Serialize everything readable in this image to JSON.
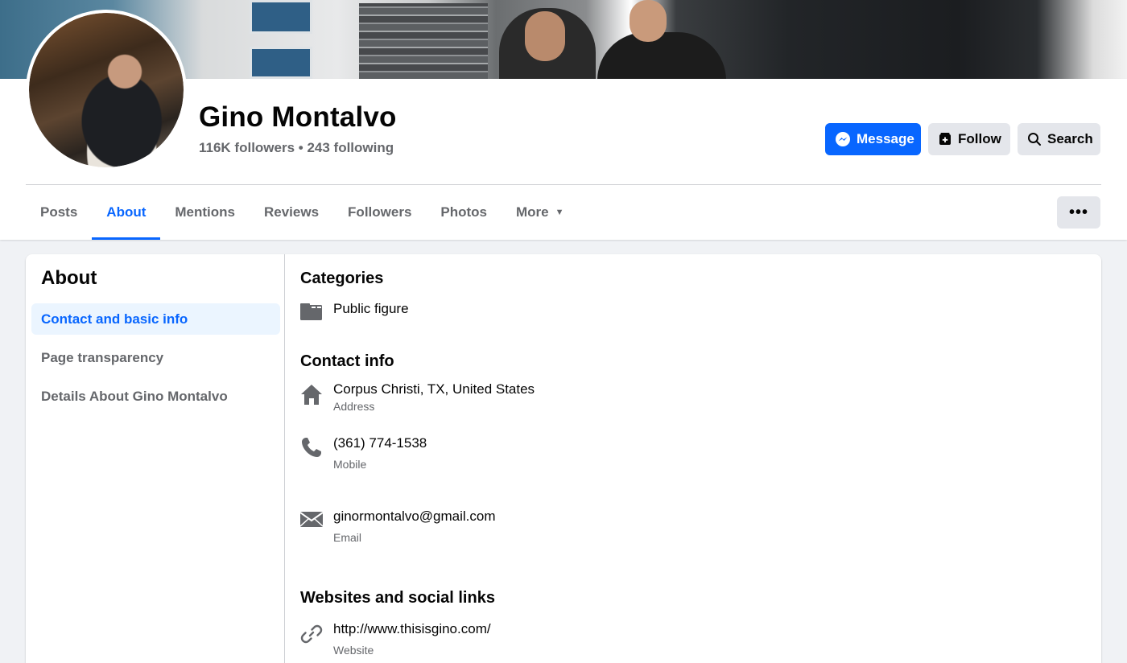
{
  "profile": {
    "name": "Gino Montalvo",
    "stats": "116K followers • 243 following"
  },
  "actions": {
    "message_label": "Message",
    "follow_label": "Follow",
    "search_label": "Search",
    "message_color": "#0866ff"
  },
  "tabs": [
    {
      "label": "Posts"
    },
    {
      "label": "About"
    },
    {
      "label": "Mentions"
    },
    {
      "label": "Reviews"
    },
    {
      "label": "Followers"
    },
    {
      "label": "Photos"
    },
    {
      "label": "More"
    }
  ],
  "more_menu_label": "•••",
  "about": {
    "title": "About",
    "nav": [
      {
        "label": "Contact and basic info"
      },
      {
        "label": "Page transparency"
      },
      {
        "label": "Details About Gino Montalvo"
      }
    ],
    "categories": {
      "title": "Categories",
      "value": "Public figure",
      "icon": "category-icon"
    },
    "contact": {
      "title": "Contact info",
      "address": {
        "value": "Corpus Christi, TX, United States",
        "label": "Address",
        "icon": "home-icon"
      },
      "phone": {
        "value": "(361) 774-1538",
        "label": "Mobile",
        "icon": "phone-icon"
      },
      "email": {
        "value": "ginormontalvo@gmail.com",
        "label": "Email",
        "icon": "email-icon"
      }
    },
    "websites": {
      "title": "Websites and social links",
      "website": {
        "value": "http://www.thisisgino.com/",
        "label": "Website",
        "icon": "link-icon"
      }
    }
  }
}
